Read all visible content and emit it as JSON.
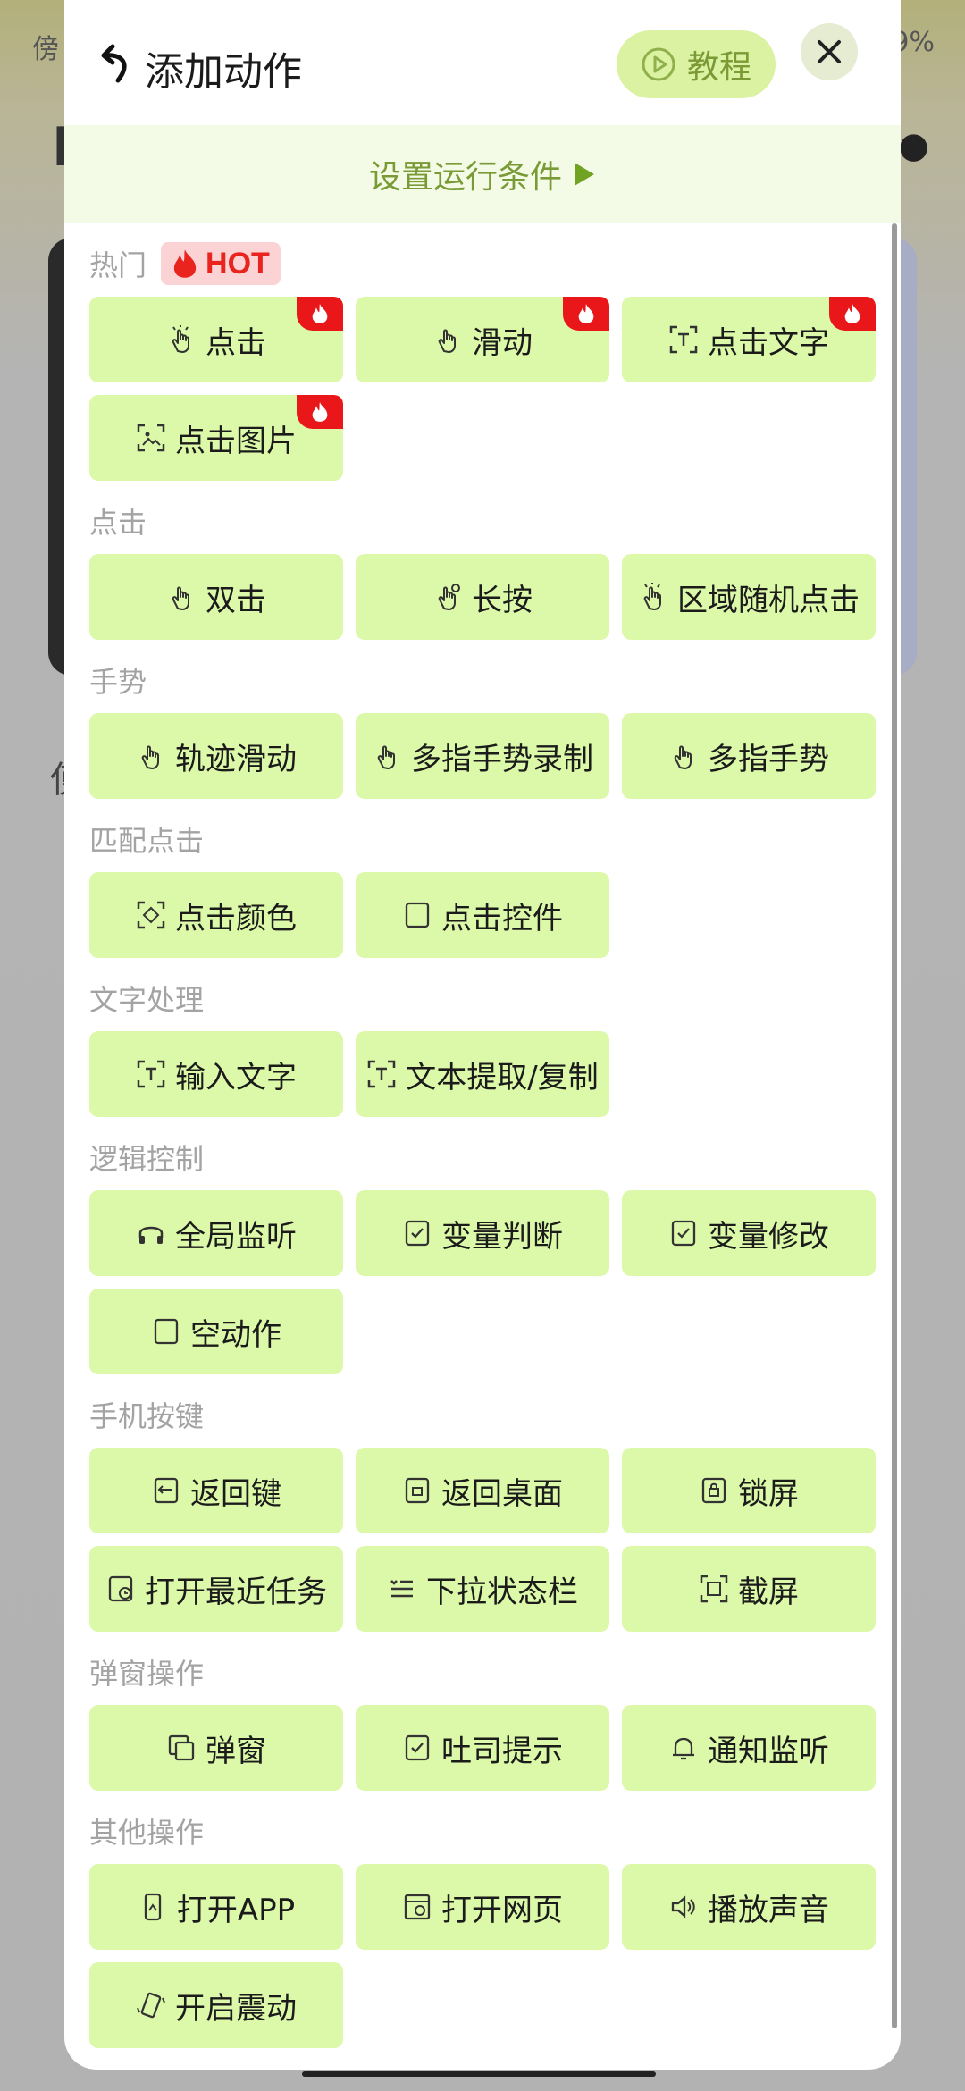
{
  "background": {
    "status_left": "傍",
    "status_right": "9%",
    "title_glyph": "B",
    "subtext": "使"
  },
  "header": {
    "title": "添加动作",
    "tutorial_label": "教程"
  },
  "conditions": {
    "label": "设置运行条件"
  },
  "sections": [
    {
      "title": "热门",
      "badge": "HOT",
      "items": [
        {
          "label": "点击",
          "icon": "tap-hand-icon",
          "hot": true
        },
        {
          "label": "滑动",
          "icon": "swipe-hand-icon",
          "hot": true
        },
        {
          "label": "点击文字",
          "icon": "text-scan-icon",
          "hot": true
        },
        {
          "label": "点击图片",
          "icon": "image-scan-icon",
          "hot": true
        }
      ]
    },
    {
      "title": "点击",
      "items": [
        {
          "label": "双击",
          "icon": "double-tap-icon"
        },
        {
          "label": "长按",
          "icon": "long-press-icon"
        },
        {
          "label": "区域随机点击",
          "icon": "random-tap-icon"
        }
      ]
    },
    {
      "title": "手势",
      "items": [
        {
          "label": "轨迹滑动",
          "icon": "trace-swipe-icon"
        },
        {
          "label": "多指手势录制",
          "icon": "multi-finger-record-icon"
        },
        {
          "label": "多指手势",
          "icon": "multi-finger-icon"
        }
      ]
    },
    {
      "title": "匹配点击",
      "items": [
        {
          "label": "点击颜色",
          "icon": "color-scan-icon"
        },
        {
          "label": "点击控件",
          "icon": "widget-cursor-icon"
        }
      ]
    },
    {
      "title": "文字处理",
      "items": [
        {
          "label": "输入文字",
          "icon": "text-input-icon"
        },
        {
          "label": "文本提取/复制",
          "icon": "text-extract-icon"
        }
      ]
    },
    {
      "title": "逻辑控制",
      "items": [
        {
          "label": "全局监听",
          "icon": "headphones-icon"
        },
        {
          "label": "变量判断",
          "icon": "variable-check-icon"
        },
        {
          "label": "变量修改",
          "icon": "variable-edit-icon"
        },
        {
          "label": "空动作",
          "icon": "blank-doc-icon"
        }
      ]
    },
    {
      "title": "手机按键",
      "items": [
        {
          "label": "返回键",
          "icon": "back-key-icon"
        },
        {
          "label": "返回桌面",
          "icon": "home-key-icon"
        },
        {
          "label": "锁屏",
          "icon": "lock-screen-icon"
        },
        {
          "label": "打开最近任务",
          "icon": "recent-tasks-icon"
        },
        {
          "label": "下拉状态栏",
          "icon": "statusbar-list-icon"
        },
        {
          "label": "截屏",
          "icon": "screenshot-icon"
        }
      ]
    },
    {
      "title": "弹窗操作",
      "items": [
        {
          "label": "弹窗",
          "icon": "popup-window-icon"
        },
        {
          "label": "吐司提示",
          "icon": "toast-icon"
        },
        {
          "label": "通知监听",
          "icon": "bell-icon"
        }
      ]
    },
    {
      "title": "其他操作",
      "items": [
        {
          "label": "打开APP",
          "icon": "open-app-icon"
        },
        {
          "label": "打开网页",
          "icon": "web-page-icon"
        },
        {
          "label": "播放声音",
          "icon": "speaker-icon"
        },
        {
          "label": "开启震动",
          "icon": "vibrate-icon"
        }
      ]
    }
  ],
  "colors": {
    "accent": "#7a9a35",
    "button_bg": "#dcf9a9",
    "hot_red": "#e9161a"
  }
}
